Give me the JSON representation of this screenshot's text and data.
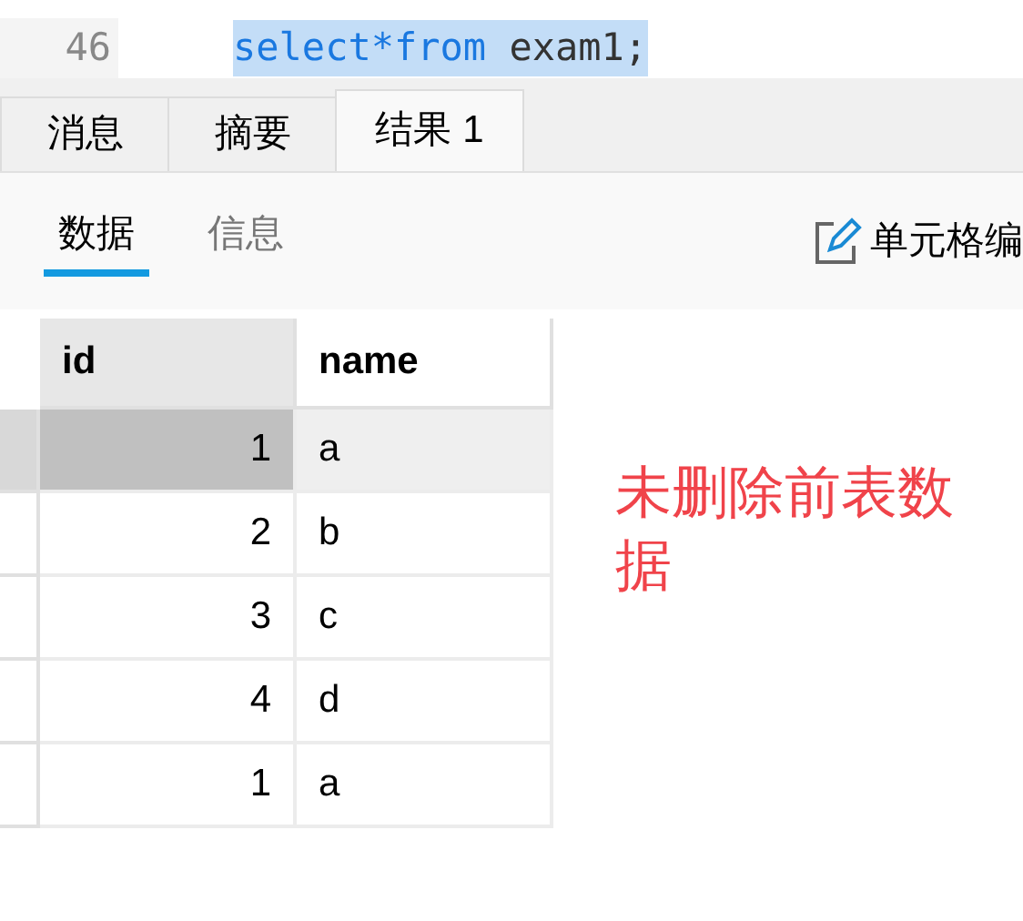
{
  "editor": {
    "lines": [
      {
        "number": "46",
        "keyword": "select*from",
        "rest": " exam1;",
        "selected": true
      }
    ]
  },
  "result_tabs": [
    {
      "label": "消息",
      "selected": false
    },
    {
      "label": "摘要",
      "selected": false
    },
    {
      "label": "结果 1",
      "selected": true
    }
  ],
  "view_tabs": [
    {
      "label": "数据",
      "selected": true
    },
    {
      "label": "信息",
      "selected": false
    }
  ],
  "toolbar": {
    "cell_edit": "单元格编"
  },
  "table": {
    "columns": [
      "id",
      "name"
    ],
    "rows": [
      {
        "cells": [
          "1",
          "a"
        ],
        "selected": true
      },
      {
        "cells": [
          "2",
          "b"
        ],
        "selected": false
      },
      {
        "cells": [
          "3",
          "c"
        ],
        "selected": false
      },
      {
        "cells": [
          "4",
          "d"
        ],
        "selected": false
      },
      {
        "cells": [
          "1",
          "a"
        ],
        "selected": false
      }
    ]
  },
  "annotation": "未删除前表数据"
}
